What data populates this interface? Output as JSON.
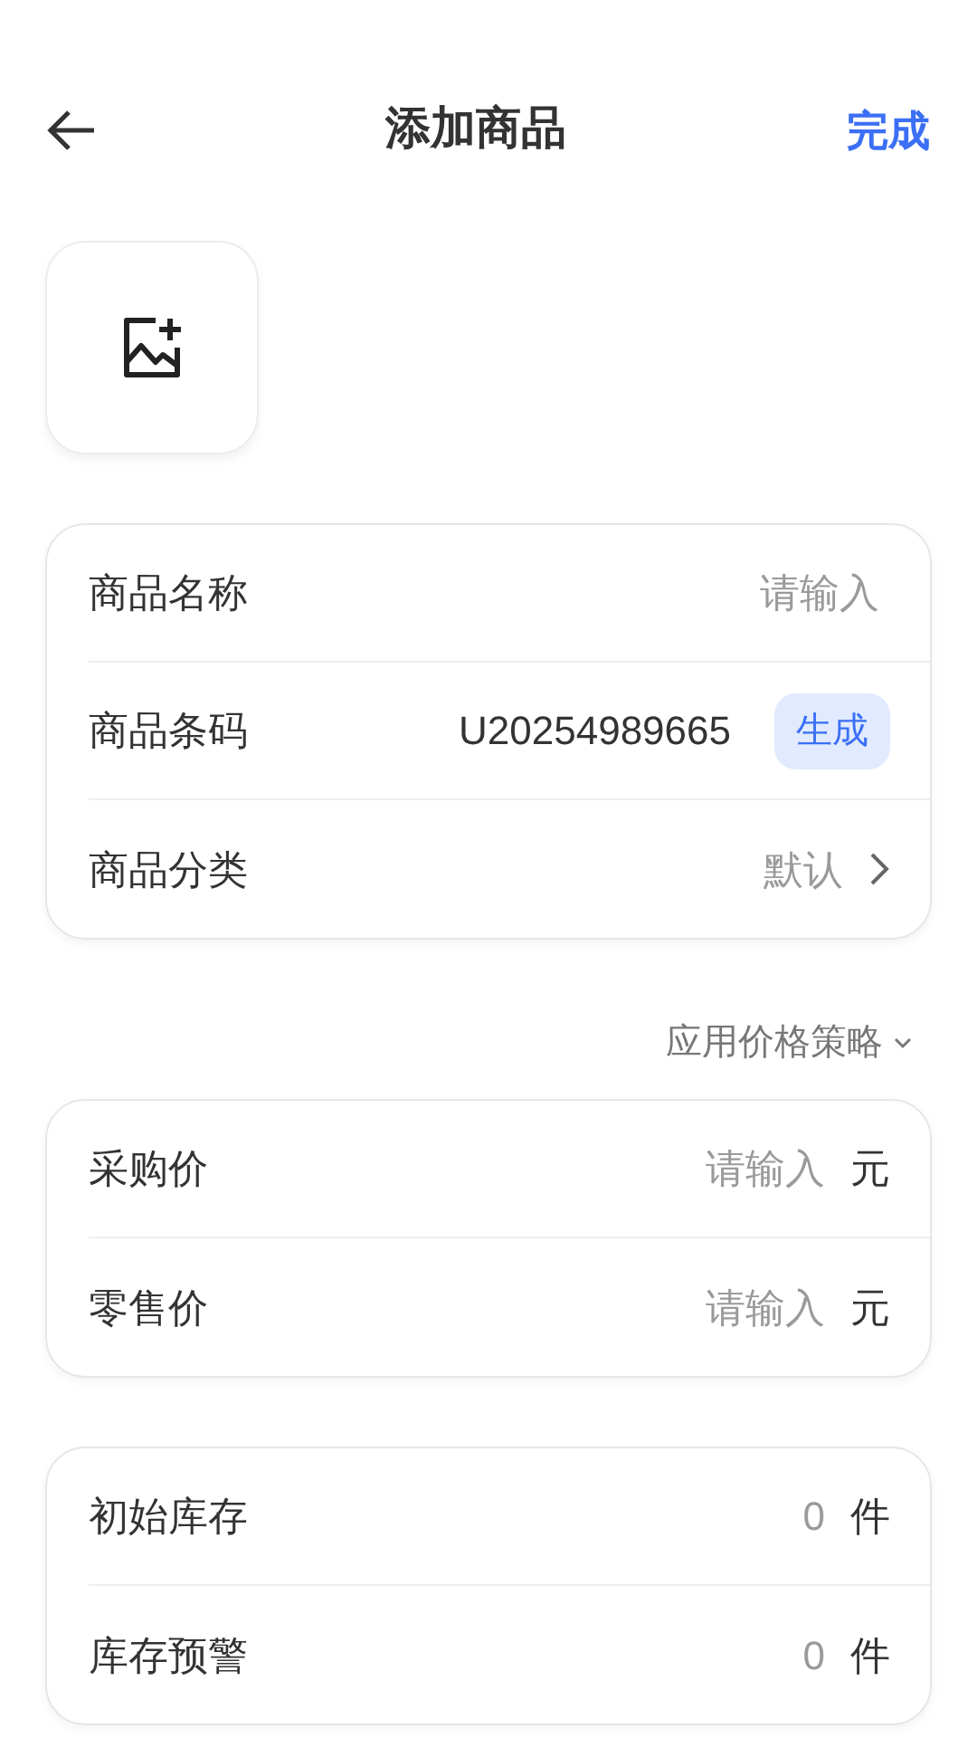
{
  "header": {
    "title": "添加商品",
    "action": "完成"
  },
  "basic_fields": [
    {
      "kind": "input",
      "label": "商品名称",
      "placeholder": "请输入"
    },
    {
      "kind": "code",
      "label": "商品条码",
      "value": "U20254989665",
      "button": "生成"
    },
    {
      "kind": "select",
      "label": "商品分类",
      "value": "默认"
    }
  ],
  "price_strategy": "应用价格策略",
  "price_fields": [
    {
      "kind": "unit",
      "label": "采购价",
      "placeholder": "请输入",
      "unit": "元"
    },
    {
      "kind": "unit",
      "label": "零售价",
      "placeholder": "请输入",
      "unit": "元"
    }
  ],
  "stock_fields": [
    {
      "kind": "unit",
      "label": "初始库存",
      "placeholder": "0",
      "unit": "件"
    },
    {
      "kind": "unit",
      "label": "库存预警",
      "placeholder": "0",
      "unit": "件"
    }
  ]
}
